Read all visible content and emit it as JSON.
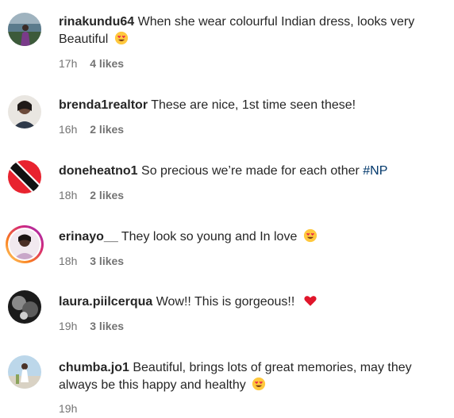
{
  "comments": [
    {
      "username": "rinakundu64",
      "text": "When she wear colourful Indian dress, looks very Beautiful",
      "emoji": "heart-eyes-emoji",
      "time": "17h",
      "likes": "4 likes"
    },
    {
      "username": "brenda1realtor",
      "text": "These are nice, 1st time seen these!",
      "time": "16h",
      "likes": "2 likes"
    },
    {
      "username": "doneheatno1",
      "text": "So precious we’re made for each other",
      "hashtag": "#NP",
      "time": "18h",
      "likes": "2 likes"
    },
    {
      "username": "erinayo__",
      "text": "They look so young and In love",
      "emoji": "heart-eyes-emoji",
      "time": "18h",
      "likes": "3 likes"
    },
    {
      "username": "laura.piilcerqua",
      "text": "Wow!! This is gorgeous!!",
      "emoji": "red-heart-emoji",
      "time": "19h",
      "likes": "3 likes"
    },
    {
      "username": "chumba.jo1",
      "text": "Beautiful, brings lots of great memories, may they always be this happy and healthy",
      "emoji": "heart-eyes-emoji",
      "time": "19h"
    }
  ],
  "colors": {
    "text": "#262626",
    "meta": "#737373",
    "hashtag": "#00376b",
    "story_ring": "#d6249f"
  }
}
